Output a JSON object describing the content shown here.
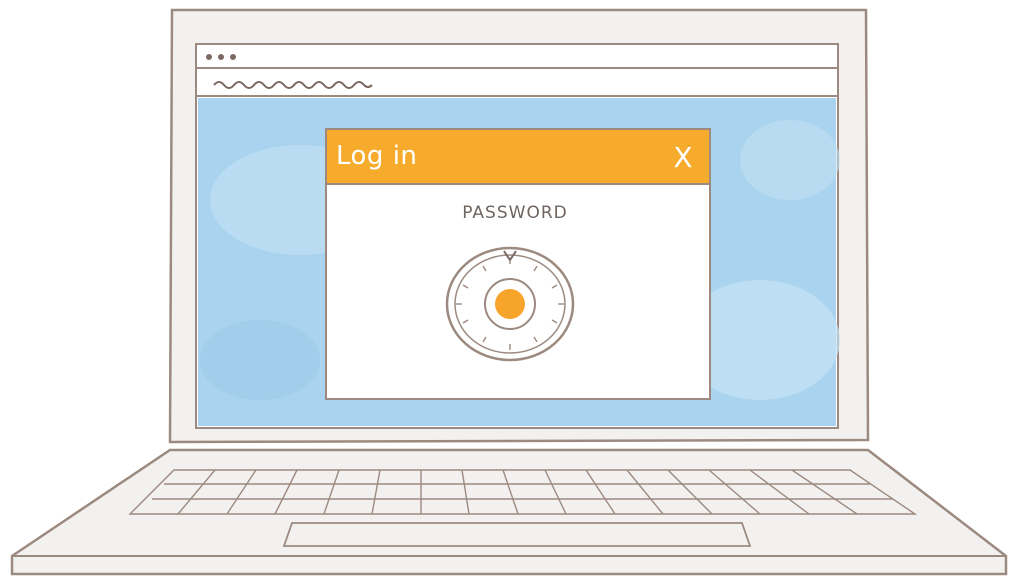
{
  "dialog": {
    "title": "Log in",
    "close_symbol": "X",
    "password_label": "PASSWORD"
  },
  "icons": {
    "close": "close-icon",
    "dial": "combination-lock-dial-icon"
  },
  "colors": {
    "title_bar": "#f7ab2c",
    "screen_bg": "#a9d3ee",
    "outline": "#9c8a80",
    "dial_center": "#f7a52a"
  }
}
